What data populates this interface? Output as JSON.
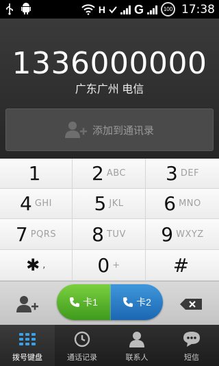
{
  "status_bar": {
    "time": "17:38",
    "battery": "100",
    "network_h": "H",
    "network_g": "G"
  },
  "dial": {
    "number": "1336000000",
    "location": "广东广州 电信",
    "add_to_contacts": "添加到通讯录"
  },
  "keypad": {
    "keys": [
      {
        "digit": "1",
        "letters": ""
      },
      {
        "digit": "2",
        "letters": "ABC"
      },
      {
        "digit": "3",
        "letters": "DEF"
      },
      {
        "digit": "4",
        "letters": "GHI"
      },
      {
        "digit": "5",
        "letters": "JKL"
      },
      {
        "digit": "6",
        "letters": "MNO"
      },
      {
        "digit": "7",
        "letters": "PQRS"
      },
      {
        "digit": "8",
        "letters": "TUV"
      },
      {
        "digit": "9",
        "letters": "WXYZ"
      },
      {
        "digit": "✱",
        "letters": ","
      },
      {
        "digit": "0",
        "letters": "+"
      },
      {
        "digit": "#",
        "letters": ""
      }
    ]
  },
  "call": {
    "sim1": "卡1",
    "sim2": "卡2",
    "sim1_color": "#4fb12a",
    "sim2_color": "#2a7cc8"
  },
  "tabs": [
    {
      "label": "拨号键盘",
      "icon": "dialpad-icon",
      "active": true
    },
    {
      "label": "通话记录",
      "icon": "clock-icon",
      "active": false
    },
    {
      "label": "联系人",
      "icon": "person-icon",
      "active": false
    },
    {
      "label": "短信",
      "icon": "chat-bubble-icon",
      "active": false
    }
  ]
}
